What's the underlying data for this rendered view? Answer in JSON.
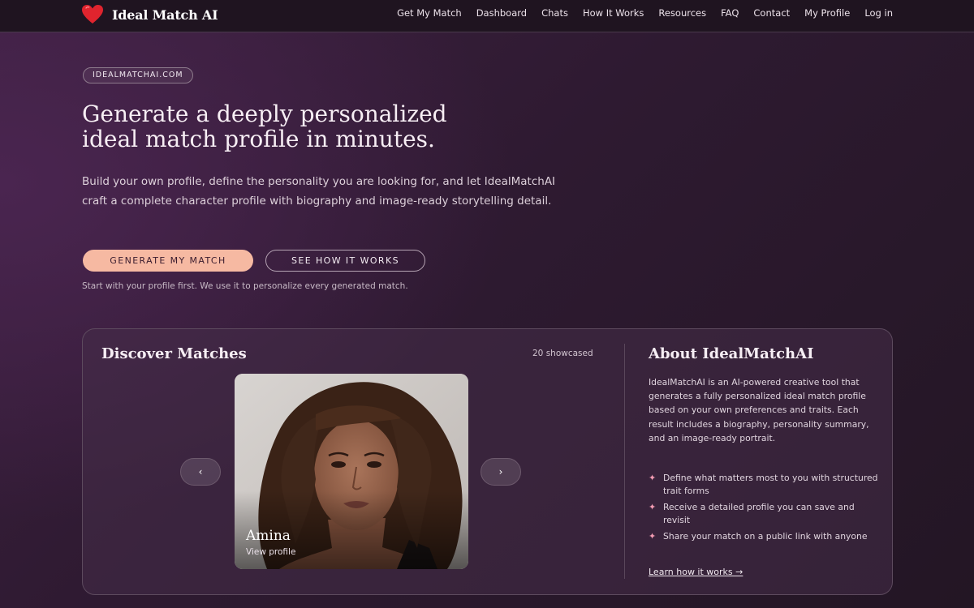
{
  "header": {
    "brand": "Ideal Match AI",
    "nav": [
      "Get My Match",
      "Dashboard",
      "Chats",
      "How It Works",
      "Resources",
      "FAQ",
      "Contact",
      "My Profile",
      "Log in"
    ]
  },
  "hero": {
    "pill": "IDEALMATCHAI.COM",
    "title_line1": "Generate a deeply personalized",
    "title_line2": "ideal match profile in minutes.",
    "description": "Build your own profile, define the personality you are looking for, and let IdealMatchAI craft a complete character profile with biography and image-ready storytelling detail.",
    "primary_button": "GENERATE MY MATCH",
    "secondary_button": "SEE HOW IT WORKS",
    "note": "Start with your profile first. We use it to personalize every generated match."
  },
  "discover": {
    "title": "Discover Matches",
    "count": "20 showcased",
    "current": {
      "name": "Amina",
      "link": "View profile"
    },
    "prev_icon": "‹",
    "next_icon": "›"
  },
  "about": {
    "title": "About IdealMatchAI",
    "description": "IdealMatchAI is an AI-powered creative tool that generates a fully personalized ideal match profile based on your own preferences and traits. Each result includes a biography, personality summary, and an image-ready portrait.",
    "bullets": [
      "Define what matters most to you with structured trait forms",
      "Receive a detailed profile you can save and revisit",
      "Share your match on a public link with anyone"
    ],
    "bullet_icon": "✦",
    "link": "Learn how it works →"
  },
  "colors": {
    "accent": "#f6b9a2",
    "bullet_star": "#f29bb2",
    "heart": "#e0242e",
    "background": "#2e1a31"
  }
}
